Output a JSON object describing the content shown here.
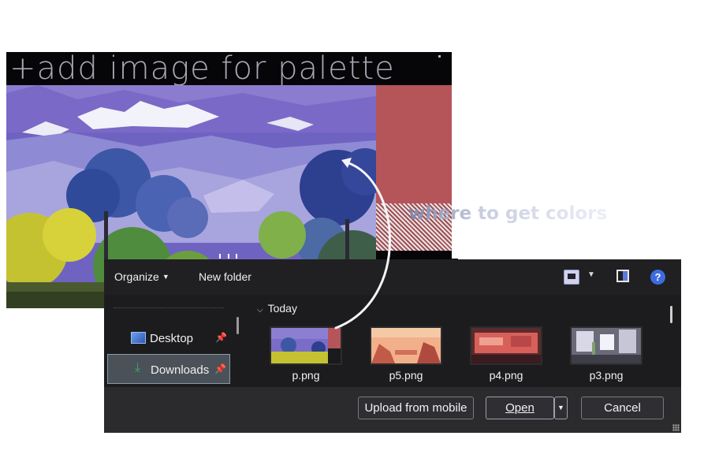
{
  "editor": {
    "title": "+add  image for palette",
    "hint": "where to get colors"
  },
  "dialog": {
    "toolbar": {
      "organize_label": "Organize",
      "new_folder_label": "New folder"
    },
    "nav": {
      "items": [
        {
          "label": "Desktop",
          "icon": "desktop-icon",
          "pinned": true
        },
        {
          "label": "Downloads",
          "icon": "downloads-icon",
          "pinned": true,
          "selected": true
        }
      ]
    },
    "content": {
      "group_header": "Today",
      "files": [
        {
          "name": "p.png"
        },
        {
          "name": "p5.png"
        },
        {
          "name": "p4.png"
        },
        {
          "name": "p3.png"
        }
      ]
    },
    "footer": {
      "upload_label": "Upload from mobile",
      "open_label": "Open",
      "cancel_label": "Cancel"
    }
  },
  "colors": {
    "palette_swatch": "#b5555a",
    "dialog_bg": "#202022",
    "accent_blue": "#3e6be0"
  }
}
